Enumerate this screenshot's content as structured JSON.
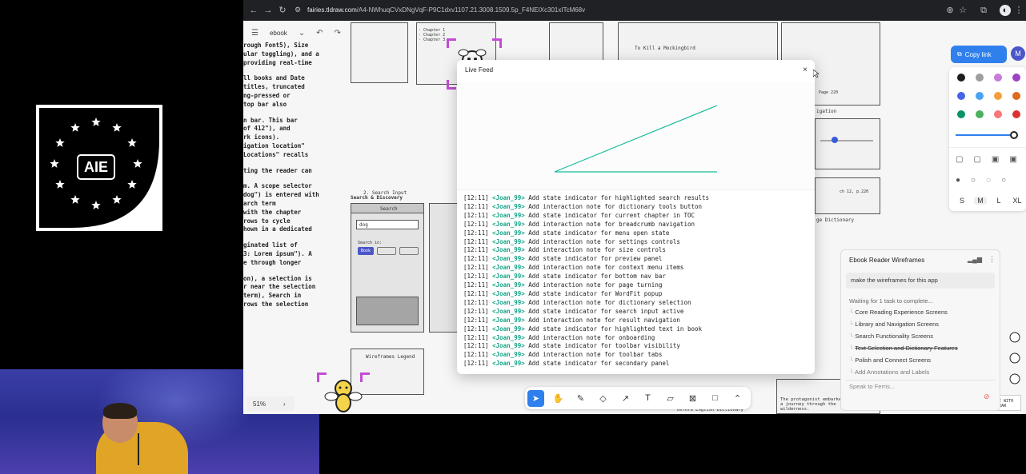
{
  "browser": {
    "url_domain": "fairies.tldraw.com",
    "url_path": "/A4-NWhuqCVxDNgVqF-P9C1dxv1107.21.3008.1509.5p_F4NEIXc301xITcM68v"
  },
  "logo": {
    "text": "AIE",
    "colors": {
      "background": "#000000",
      "stars": "#ffffff"
    }
  },
  "editor": {
    "page_name": "ebook",
    "zoom": "51%",
    "share_label": "Copy link",
    "avatar_initial": "M",
    "sizes": [
      "S",
      "M",
      "L",
      "XL"
    ],
    "active_size": "M",
    "colors": [
      "#1d1d1d",
      "#9e9e9e",
      "#c77bdb",
      "#9c40c6",
      "#4465e9",
      "#4ba1f1",
      "#f2a03a",
      "#e16919",
      "#099268",
      "#4cb05e",
      "#f87777",
      "#e03131"
    ],
    "tools": [
      "select",
      "hand",
      "draw",
      "eraser",
      "arrow",
      "text",
      "note",
      "image",
      "rectangle",
      "more"
    ],
    "active_tool": "select"
  },
  "canvas_notes": {
    "left_column": [
      "rough Font5), Size",
      "ular toggling), and a",
      "providing real-time",
      "",
      "ll books and Date",
      "titles, truncated",
      "ng-pressed or",
      "top bar also",
      "",
      "n bar. This bar",
      "of 412\"), and",
      "rk icons).",
      "igation location\"",
      "Locations\" recalls",
      "",
      "ting the reader can",
      "",
      "m. A scope selector",
      "dog\") is entered with",
      "arch term",
      "with the chapter",
      "rows to cycle",
      "hown in a dedicated",
      "",
      "ginated list of",
      "3: Lorem ipsum\"). A",
      "e through longer",
      "",
      "on), a selection is",
      "r near the selection",
      "term), Search in",
      "rows the selection"
    ],
    "search_section": "2. Search Input",
    "search_discovery": "Search & Discovery",
    "search_title": "Search",
    "search_query": "dog",
    "search_in": "Search in:",
    "search_button": "Book",
    "legend_title": "Wireframes Legend",
    "kill_mockingbird": "To Kill a Mockingbird",
    "page_220": "Page 220",
    "navigation": "igation",
    "chapter_label": "ch 12, p.220",
    "dictionary": "ge Dictionary",
    "protagonist": "The protagonist embarked on a journey through the wilderness.",
    "oxford": "Oxford English Dictionary",
    "tldraw_badge": "MADE WITH TLDRAW"
  },
  "live_feed": {
    "title": "Live Feed",
    "close_label": "×",
    "entries": [
      {
        "time": "[12:11]",
        "user": "<Joan_99>",
        "text": "Add state indicator for highlighted search results"
      },
      {
        "time": "[12:11]",
        "user": "<Joan_99>",
        "text": "Add interaction note for dictionary tools button"
      },
      {
        "time": "[12:11]",
        "user": "<Joan_99>",
        "text": "Add state indicator for current chapter in TOC"
      },
      {
        "time": "[12:11]",
        "user": "<Joan_99>",
        "text": "Add interaction note for breadcrumb navigation"
      },
      {
        "time": "[12:11]",
        "user": "<Joan_99>",
        "text": "Add state indicator for menu open state"
      },
      {
        "time": "[12:11]",
        "user": "<Joan_99>",
        "text": "Add interaction note for settings controls"
      },
      {
        "time": "[12:11]",
        "user": "<Joan_99>",
        "text": "Add interaction note for size controls"
      },
      {
        "time": "[12:11]",
        "user": "<Joan_99>",
        "text": "Add state indicator for preview panel"
      },
      {
        "time": "[12:11]",
        "user": "<Joan_99>",
        "text": "Add interaction note for context menu items"
      },
      {
        "time": "[12:11]",
        "user": "<Joan_99>",
        "text": "Add state indicator for bottom nav bar"
      },
      {
        "time": "[12:11]",
        "user": "<Joan_99>",
        "text": "Add interaction note for page turning"
      },
      {
        "time": "[12:11]",
        "user": "<Joan_99>",
        "text": "Add state indicator for WordFit popup"
      },
      {
        "time": "[12:11]",
        "user": "<Joan_99>",
        "text": "Add interaction note for dictionary selection"
      },
      {
        "time": "[12:11]",
        "user": "<Joan_99>",
        "text": "Add state indicator for search input active"
      },
      {
        "time": "[12:11]",
        "user": "<Joan_99>",
        "text": "Add interaction note for result navigation"
      },
      {
        "time": "[12:11]",
        "user": "<Joan_99>",
        "text": "Add state indicator for highlighted text in book"
      },
      {
        "time": "[12:11]",
        "user": "<Joan_99>",
        "text": "Add interaction note for onboarding"
      },
      {
        "time": "[12:11]",
        "user": "<Joan_99>",
        "text": "Add state indicator for toolbar visibility"
      },
      {
        "time": "[12:11]",
        "user": "<Joan_99>",
        "text": "Add interaction note for toolbar tabs"
      },
      {
        "time": "[12:11]",
        "user": "<Joan_99>",
        "text": "Add state indicator for secondary panel"
      }
    ],
    "line_color": "#1abc9c"
  },
  "chat": {
    "title": "Ebook Reader Wireframes",
    "prompt": "make the wireframes for this app",
    "status": "Waiting for 1 task to complete...",
    "tasks": [
      {
        "label": "Core Reading Experience Screens",
        "done": true
      },
      {
        "label": "Library and Navigation Screens",
        "done": true
      },
      {
        "label": "Search Functionality Screens",
        "done": true
      },
      {
        "label": "Text Selection and Dictionary Features",
        "done": true
      },
      {
        "label": "Polish and Connect Screens",
        "done": true
      },
      {
        "label": "Add Annotations and Labels",
        "done": false
      }
    ],
    "input_placeholder": "Speak to Ferris..."
  }
}
